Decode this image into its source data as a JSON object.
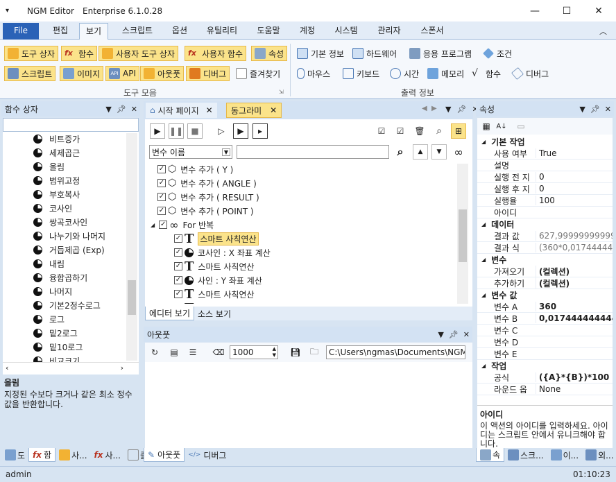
{
  "window": {
    "title": "NGM Editor",
    "edition": "Enterprise 6.1.0.28"
  },
  "menu_tabs": [
    "File",
    "편집",
    "보기",
    "스크립트",
    "옵션",
    "유틸리티",
    "도움말",
    "계정",
    "시스템",
    "관리자",
    "스폰서"
  ],
  "ribbon": {
    "left_row1": [
      "도구 상자",
      "함수",
      "사용자 도구 상자",
      "사용자 함수",
      "속성"
    ],
    "left_row2": [
      "스크립트",
      "이미지",
      "API",
      "아웃풋",
      "디버그",
      "즐겨찾기"
    ],
    "left_group": "도구 모음",
    "right_row1": [
      "기본 정보",
      "하드웨어",
      "응용 프로그램",
      "조건"
    ],
    "right_row2": [
      "마우스",
      "키보드",
      "시간",
      "메모리",
      "함수",
      "디버그"
    ],
    "right_group": "출력 정보"
  },
  "func_panel": {
    "title": "함수 상자",
    "items": [
      "비트증가",
      "세제곱근",
      "올림",
      "범위고정",
      "부호복사",
      "코사인",
      "쌍곡코사인",
      "나누기와 나머지",
      "거듭제곱 (Exp)",
      "내림",
      "융합곱하기",
      "나머지",
      "기본2정수로그",
      "로그",
      "밑2로그",
      "밑10로그",
      "비교크기"
    ],
    "desc_title": "올림",
    "desc_text": "지정된 수보다 크거나 같은 최소 정수 값을 반환합니다.",
    "bottom_tabs": [
      "도",
      "함",
      "사...",
      "사...",
      "즐"
    ]
  },
  "doc_tabs": [
    "시작 페이지",
    "동그라미"
  ],
  "editor": {
    "search_combo": "변수 이름",
    "search_text": "",
    "rows": [
      {
        "label": "변수 추가 ( Y )",
        "indent": 0,
        "icon": "cube"
      },
      {
        "label": "변수 추가 ( ANGLE )",
        "indent": 0,
        "icon": "cube"
      },
      {
        "label": "변수 추가 ( RESULT )",
        "indent": 0,
        "icon": "cube"
      },
      {
        "label": "변수 추가 ( POINT )",
        "indent": 0,
        "icon": "cube"
      },
      {
        "label": "For 반복",
        "indent": 0,
        "icon": "loop"
      },
      {
        "label": "스마트 사칙연산",
        "indent": 1,
        "icon": "T",
        "selected": true
      },
      {
        "label": "코사인 : X 좌표 계산",
        "indent": 1,
        "icon": "pie"
      },
      {
        "label": "스마트 사칙연산",
        "indent": 1,
        "icon": "T"
      },
      {
        "label": "사인 : Y 좌표 계산",
        "indent": 1,
        "icon": "pie"
      },
      {
        "label": "스마트 사칙연산",
        "indent": 1,
        "icon": "T"
      },
      {
        "label": "스마트 사칙연산",
        "indent": 1,
        "icon": "T"
      }
    ],
    "bottom_tabs": [
      "에디터 보기",
      "소스 보기"
    ]
  },
  "output": {
    "title": "아웃풋",
    "count": "1000",
    "path": "C:\\Users\\ngmas\\Documents\\NGM6\\",
    "bottom_tabs": [
      "아웃풋",
      "디버그"
    ]
  },
  "props": {
    "title": "속성",
    "sections": [
      {
        "name": "기본 작업",
        "rows": [
          [
            "사용 여부",
            "True"
          ],
          [
            "설명",
            ""
          ],
          [
            "실행 전 지",
            "0"
          ],
          [
            "실행 후 지",
            "0"
          ],
          [
            "실행율",
            "100"
          ],
          [
            "아이디",
            ""
          ]
        ]
      },
      {
        "name": "데이터",
        "rows": [
          [
            "결과 값",
            "627,99999999999841"
          ],
          [
            "결과 식",
            "(360*0,0174444444444"
          ]
        ]
      },
      {
        "name": "변수",
        "rows": [
          [
            "가져오기",
            "(컬렉션)"
          ],
          [
            "추가하기",
            "(컬렉션)"
          ]
        ]
      },
      {
        "name": "변수 값",
        "rows": [
          [
            "변수 A",
            "360"
          ],
          [
            "변수 B",
            "0,0174444444444444"
          ],
          [
            "변수 C",
            ""
          ],
          [
            "변수 D",
            ""
          ],
          [
            "변수 E",
            ""
          ]
        ]
      },
      {
        "name": "작업",
        "rows": [
          [
            "공식",
            "({A}*{B})*100"
          ],
          [
            "라운드 옵",
            "None"
          ]
        ]
      }
    ],
    "desc_title": "아이디",
    "desc_text": "이 액션의 아이디를 입력하세요. 아이디는 스크립트 안에서 유니크해야 합니다.",
    "bottom_tabs": [
      "속",
      "스크...",
      "이...",
      "외..."
    ]
  },
  "status": {
    "user": "admin",
    "time": "01:10:23"
  }
}
